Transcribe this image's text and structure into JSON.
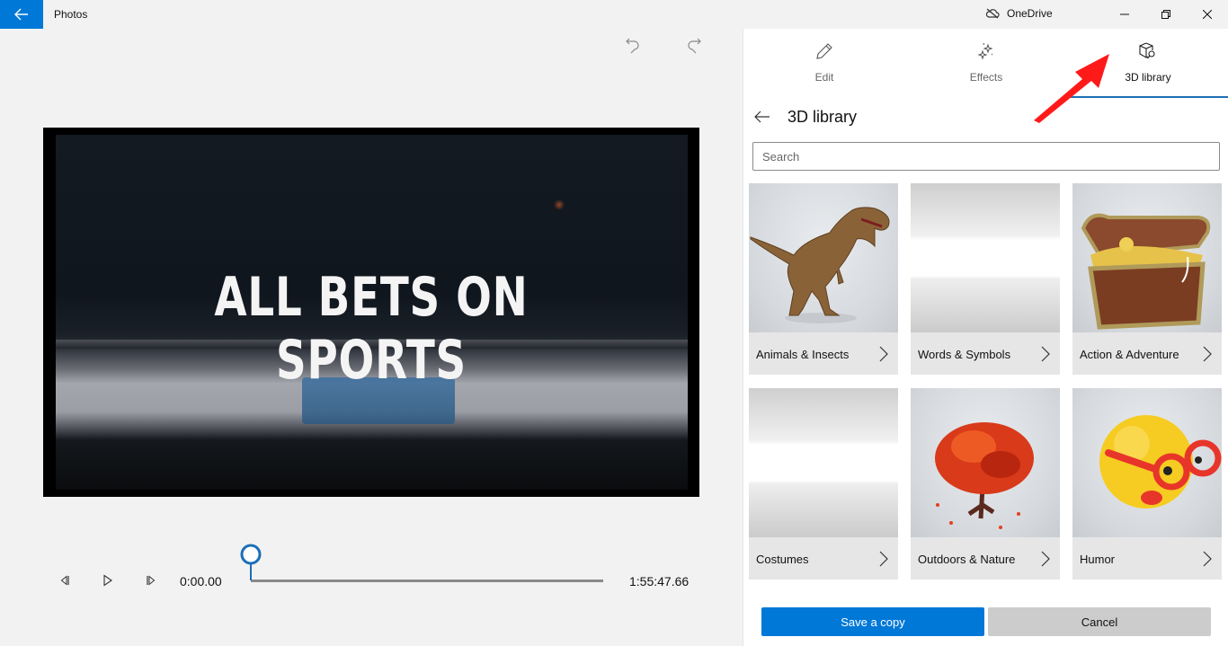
{
  "titlebar": {
    "app_title": "Photos",
    "back_icon": "arrow-left-icon",
    "onedrive_label": "OneDrive",
    "onedrive_icon": "cloud-offline-icon",
    "minimize_icon": "minimize-icon",
    "maximize_icon": "restore-icon",
    "close_icon": "close-icon",
    "accent_color": "#0078d7"
  },
  "editor": {
    "undo_icon": "undo-icon",
    "redo_icon": "redo-icon",
    "video_overlay_text": "ALL BETS ON SPORTS",
    "playback": {
      "current_time": "0:00.00",
      "total_time": "1:55:47.66",
      "progress": 0,
      "prev_frame_icon": "step-back-icon",
      "play_icon": "play-icon",
      "next_frame_icon": "step-forward-icon"
    }
  },
  "panel": {
    "tabs": [
      {
        "label": "Edit",
        "icon": "pencil-icon",
        "active": false
      },
      {
        "label": "Effects",
        "icon": "sparkle-icon",
        "active": false
      },
      {
        "label": "3D library",
        "icon": "cube-search-icon",
        "active": true
      }
    ],
    "active_tab_color": "#1e6fb5",
    "header_title": "3D library",
    "search_placeholder": "Search",
    "search_value": "",
    "categories": [
      {
        "label": "Animals & Insects",
        "thumb": "t-rex"
      },
      {
        "label": "Words & Symbols",
        "thumb": "blank"
      },
      {
        "label": "Action & Adventure",
        "thumb": "treasure-chest"
      },
      {
        "label": "Costumes",
        "thumb": "blank"
      },
      {
        "label": "Outdoors & Nature",
        "thumb": "red-tree"
      },
      {
        "label": "Humor",
        "thumb": "emoji-glasses"
      }
    ],
    "save_label": "Save a copy",
    "cancel_label": "Cancel"
  },
  "annotation": {
    "arrow_color": "#ff0000",
    "points_to": "3D library tab"
  }
}
